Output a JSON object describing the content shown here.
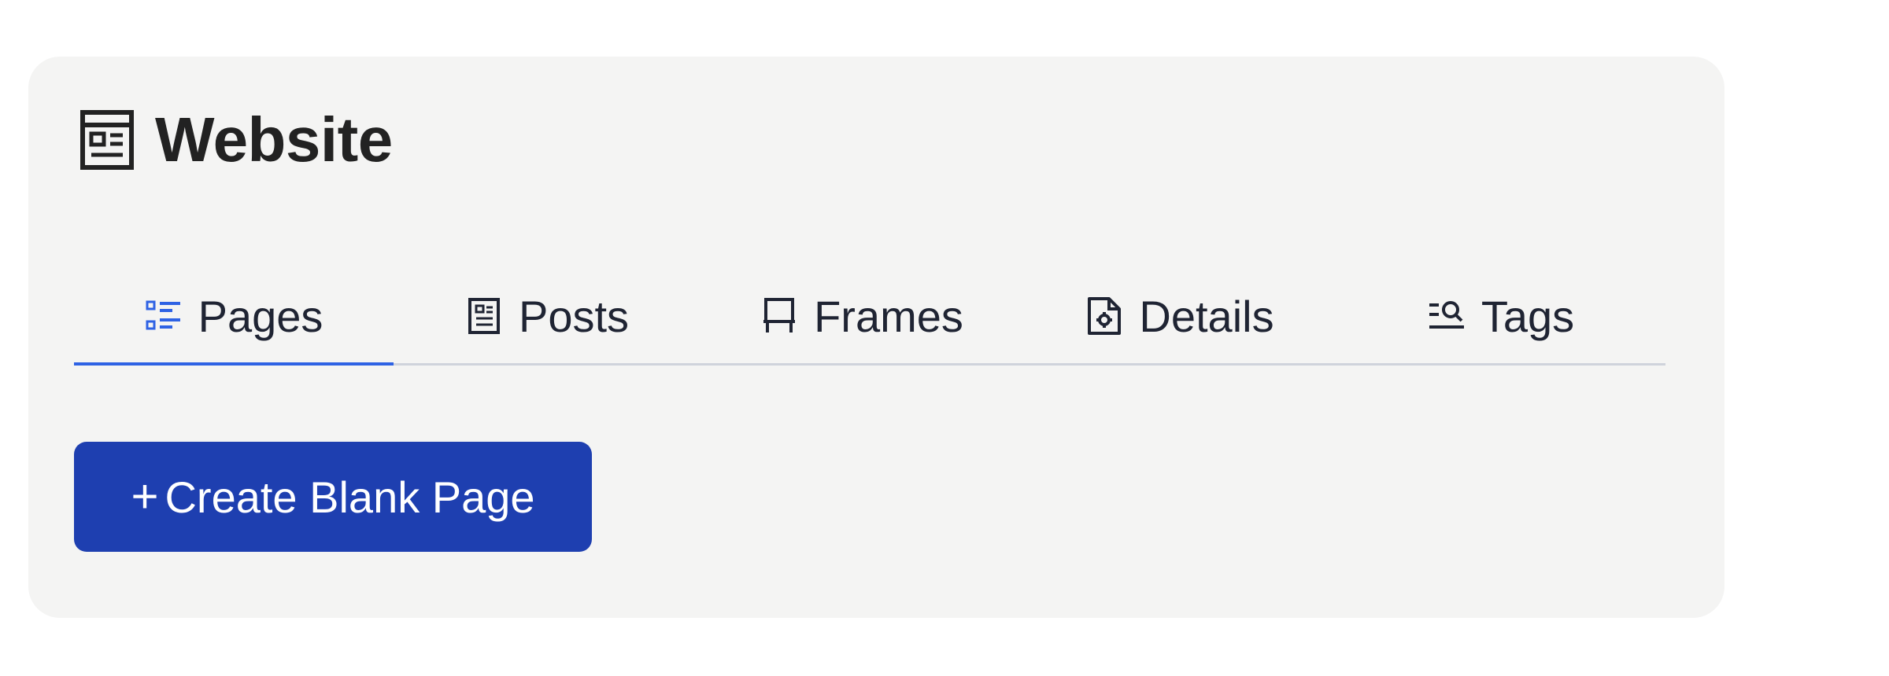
{
  "header": {
    "title": "Website",
    "icon": "newspaper-icon"
  },
  "tabs": [
    {
      "label": "Pages",
      "icon": "list-icon",
      "active": true
    },
    {
      "label": "Posts",
      "icon": "document-icon",
      "active": false
    },
    {
      "label": "Frames",
      "icon": "frame-icon",
      "active": false
    },
    {
      "label": "Details",
      "icon": "file-gear-icon",
      "active": false
    },
    {
      "label": "Tags",
      "icon": "tag-search-icon",
      "active": false
    }
  ],
  "actions": {
    "create_symbol": "+",
    "create_label": "Create Blank Page"
  },
  "colors": {
    "accent": "#2e62e4",
    "button": "#1e3fb0",
    "panel": "#f4f4f3",
    "text": "#1f2433"
  }
}
